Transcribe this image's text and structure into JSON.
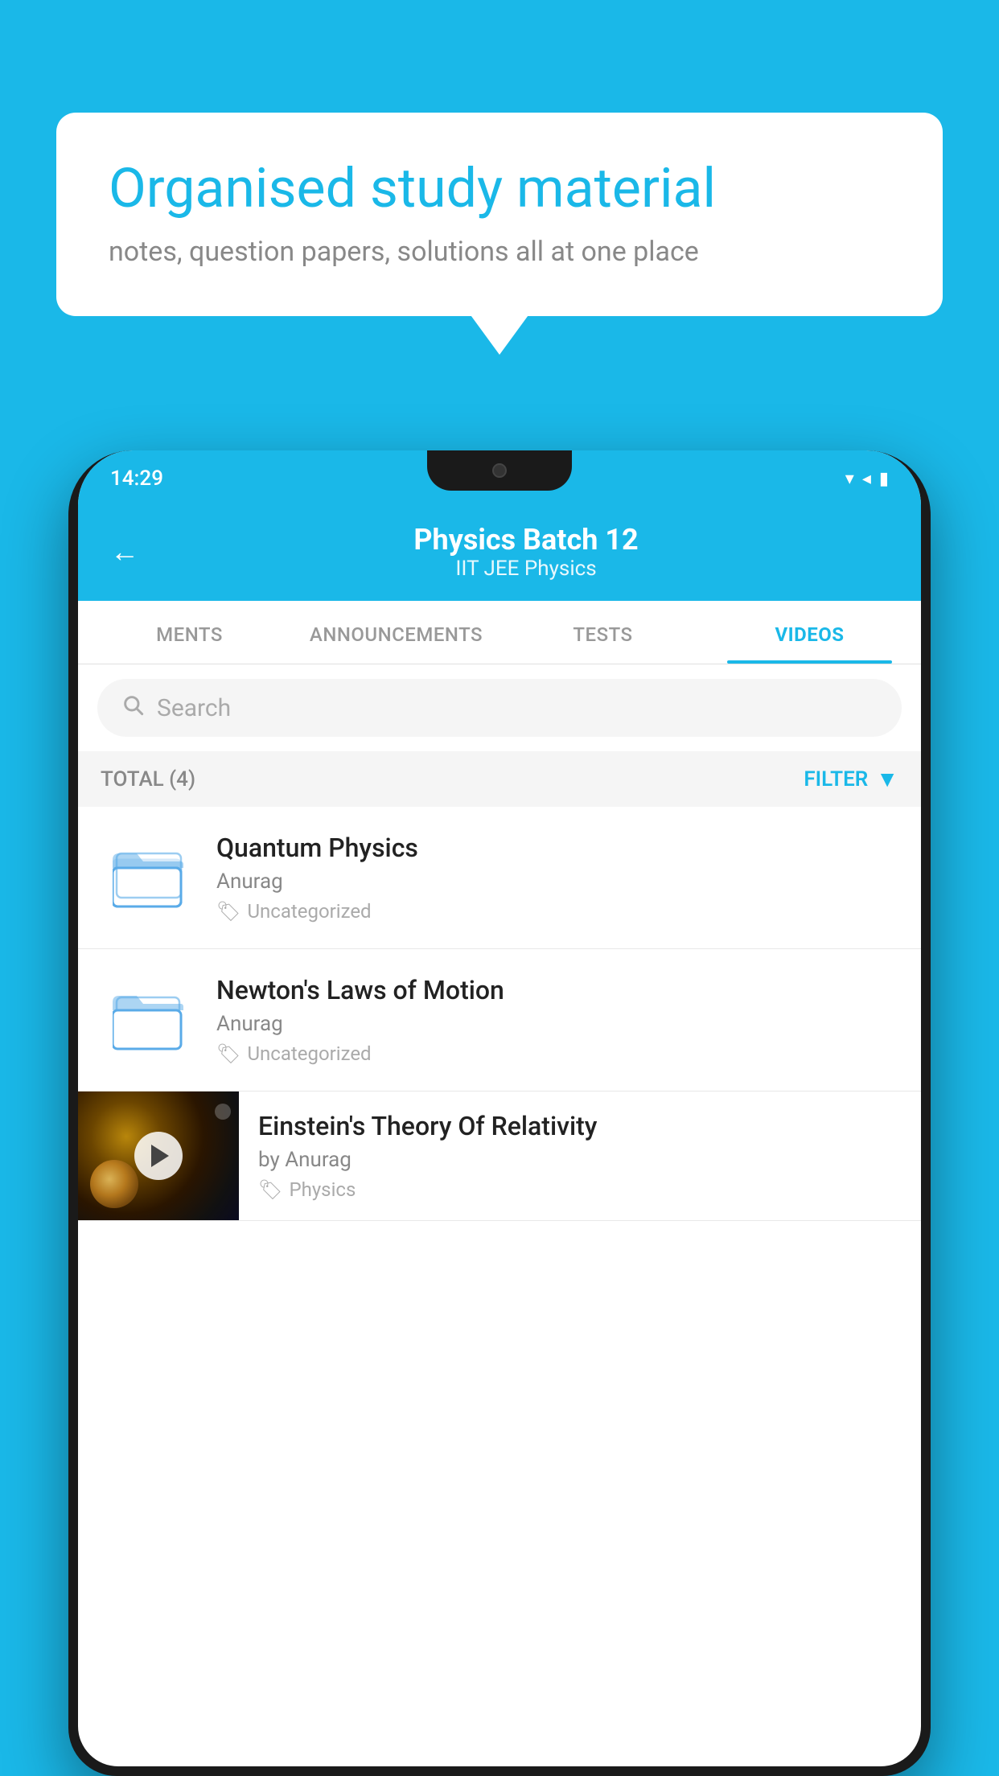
{
  "background_color": "#1ab8e8",
  "speech_bubble": {
    "title": "Organised study material",
    "subtitle": "notes, question papers, solutions all at one place"
  },
  "phone": {
    "status_bar": {
      "time": "14:29",
      "icons": "▾◂▮"
    },
    "header": {
      "title": "Physics Batch 12",
      "subtitle": "IIT JEE   Physics",
      "back_label": "←"
    },
    "tabs": [
      {
        "label": "MENTS",
        "active": false
      },
      {
        "label": "ANNOUNCEMENTS",
        "active": false
      },
      {
        "label": "TESTS",
        "active": false
      },
      {
        "label": "VIDEOS",
        "active": true
      }
    ],
    "search": {
      "placeholder": "Search"
    },
    "filter": {
      "total_label": "TOTAL (4)",
      "filter_label": "FILTER"
    },
    "videos": [
      {
        "id": 1,
        "title": "Quantum Physics",
        "author": "Anurag",
        "tag": "Uncategorized",
        "type": "folder"
      },
      {
        "id": 2,
        "title": "Newton's Laws of Motion",
        "author": "Anurag",
        "tag": "Uncategorized",
        "type": "folder"
      },
      {
        "id": 3,
        "title": "Einstein's Theory Of Relativity",
        "author": "by Anurag",
        "tag": "Physics",
        "type": "video"
      }
    ]
  }
}
